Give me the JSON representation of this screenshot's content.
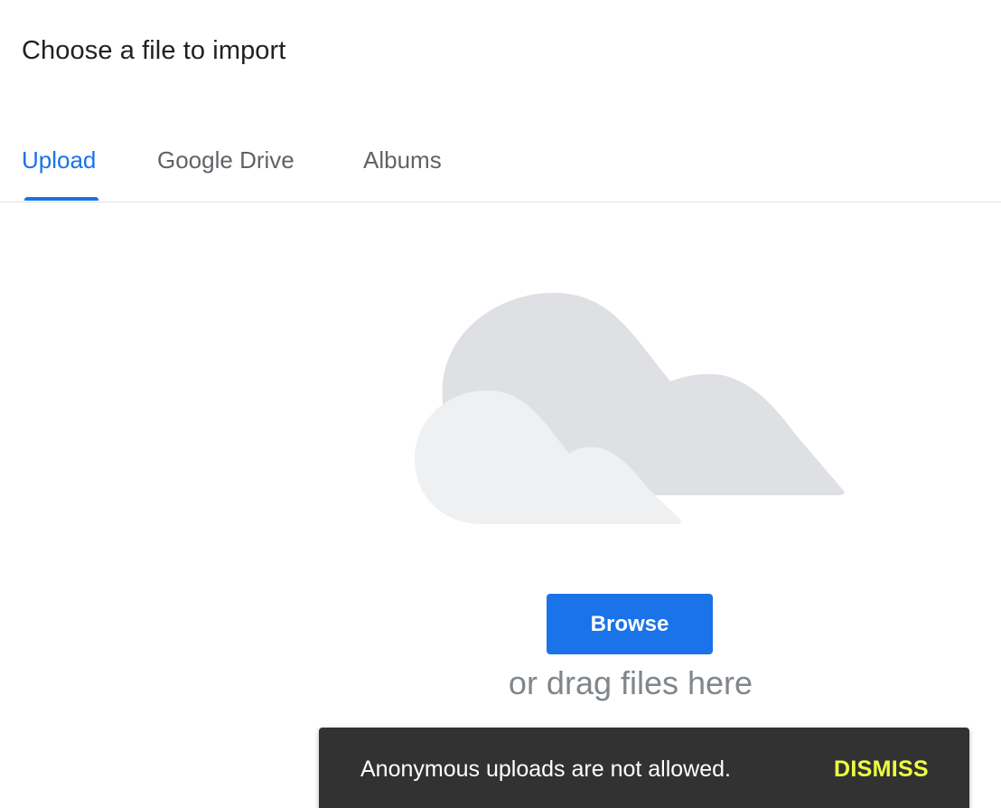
{
  "dialog": {
    "title": "Choose a file to import"
  },
  "tabs": [
    {
      "label": "Upload",
      "active": true
    },
    {
      "label": "Google Drive",
      "active": false
    },
    {
      "label": "Albums",
      "active": false
    }
  ],
  "upload": {
    "illustration_icon": "cloud-icon",
    "browse_label": "Browse",
    "drag_hint": "or drag files here"
  },
  "snackbar": {
    "message": "Anonymous uploads are not allowed.",
    "action_label": "DISMISS"
  },
  "colors": {
    "accent": "#1a73e8",
    "snackbar_bg": "#323232",
    "snackbar_action": "#eeff41",
    "cloud_back": "#dfe0e4",
    "cloud_front": "#eff0f2"
  }
}
